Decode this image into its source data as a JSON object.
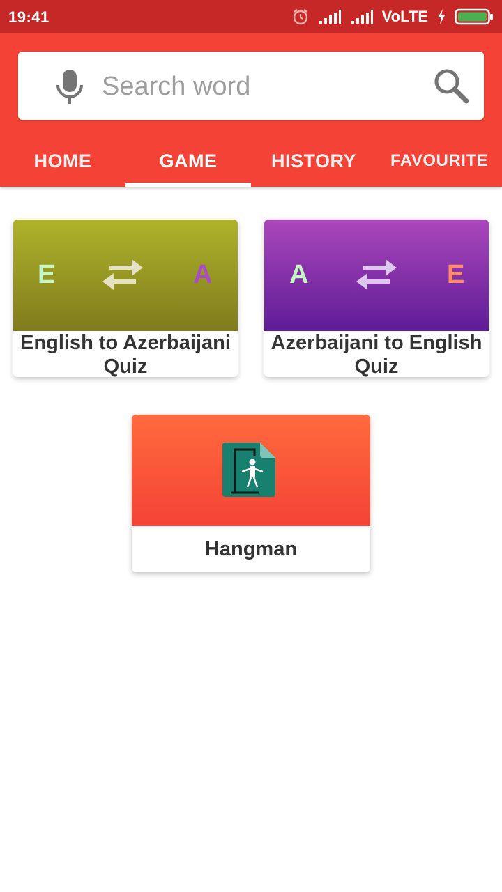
{
  "status_bar": {
    "time": "19:41",
    "network": "VoLTE",
    "icons": [
      "alarm-icon",
      "signal-icon",
      "signal-icon",
      "charging-icon",
      "battery-icon"
    ]
  },
  "search": {
    "placeholder": "Search word",
    "mic_icon": "mic-icon",
    "search_icon": "search-icon"
  },
  "tabs": [
    {
      "label": "HOME",
      "active": false
    },
    {
      "label": "GAME",
      "active": true
    },
    {
      "label": "HISTORY",
      "active": false
    },
    {
      "label": "FAVOURITE",
      "active": false
    }
  ],
  "cards": [
    {
      "title": "English to Azerbaijani Quiz",
      "left_letter": "E",
      "right_letter": "A",
      "left_color": "#c5f5c0",
      "right_color": "#a84bc4",
      "banner_colors": [
        "#aeb32a",
        "#807b1d"
      ],
      "icon": "swap-arrows-icon"
    },
    {
      "title": "Azerbaijani to English Quiz",
      "left_letter": "A",
      "right_letter": "E",
      "left_color": "#c5f5c0",
      "right_color": "#ff8a65",
      "banner_colors": [
        "#ab47bc",
        "#5e1c96"
      ],
      "icon": "swap-arrows-icon"
    },
    {
      "title": "Hangman",
      "banner_colors": [
        "#ff6a3d",
        "#f44336"
      ],
      "icon": "hangman-icon"
    }
  ],
  "colors": {
    "status_bar": "#c62828",
    "app_bar": "#f44336",
    "card_text": "#333333"
  }
}
